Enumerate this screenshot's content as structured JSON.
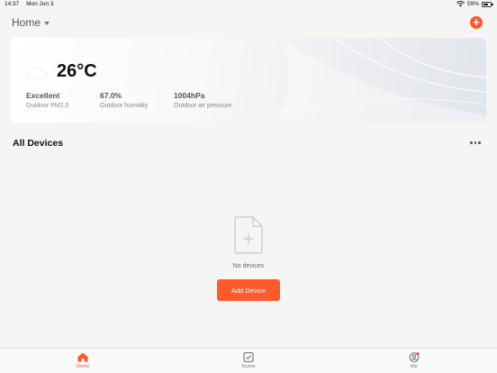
{
  "status_bar": {
    "time": "14:37",
    "date": "Mon Jun 3",
    "battery": "59%",
    "battery_level": 0.59
  },
  "header": {
    "home_label": "Home",
    "add_icon": "plus-icon"
  },
  "weather": {
    "icon": "cloud-icon",
    "temperature": "26°C",
    "stats": [
      {
        "value": "Excellent",
        "label": "Outdoor PM2.5"
      },
      {
        "value": "67.0%",
        "label": "Outdoor humidity"
      },
      {
        "value": "1004hPa",
        "label": "Outdoor air pressure"
      }
    ]
  },
  "devices": {
    "title": "All Devices",
    "more_icon": "more-dots-icon",
    "empty_text": "No devices",
    "add_button": "Add Device"
  },
  "tabs": [
    {
      "label": "Home",
      "icon": "home-icon",
      "active": true
    },
    {
      "label": "Scene",
      "icon": "scene-icon",
      "active": false
    },
    {
      "label": "Me",
      "icon": "profile-icon",
      "active": false
    }
  ],
  "colors": {
    "accent": "#ff5a2c",
    "background": "#f5f5f6"
  }
}
